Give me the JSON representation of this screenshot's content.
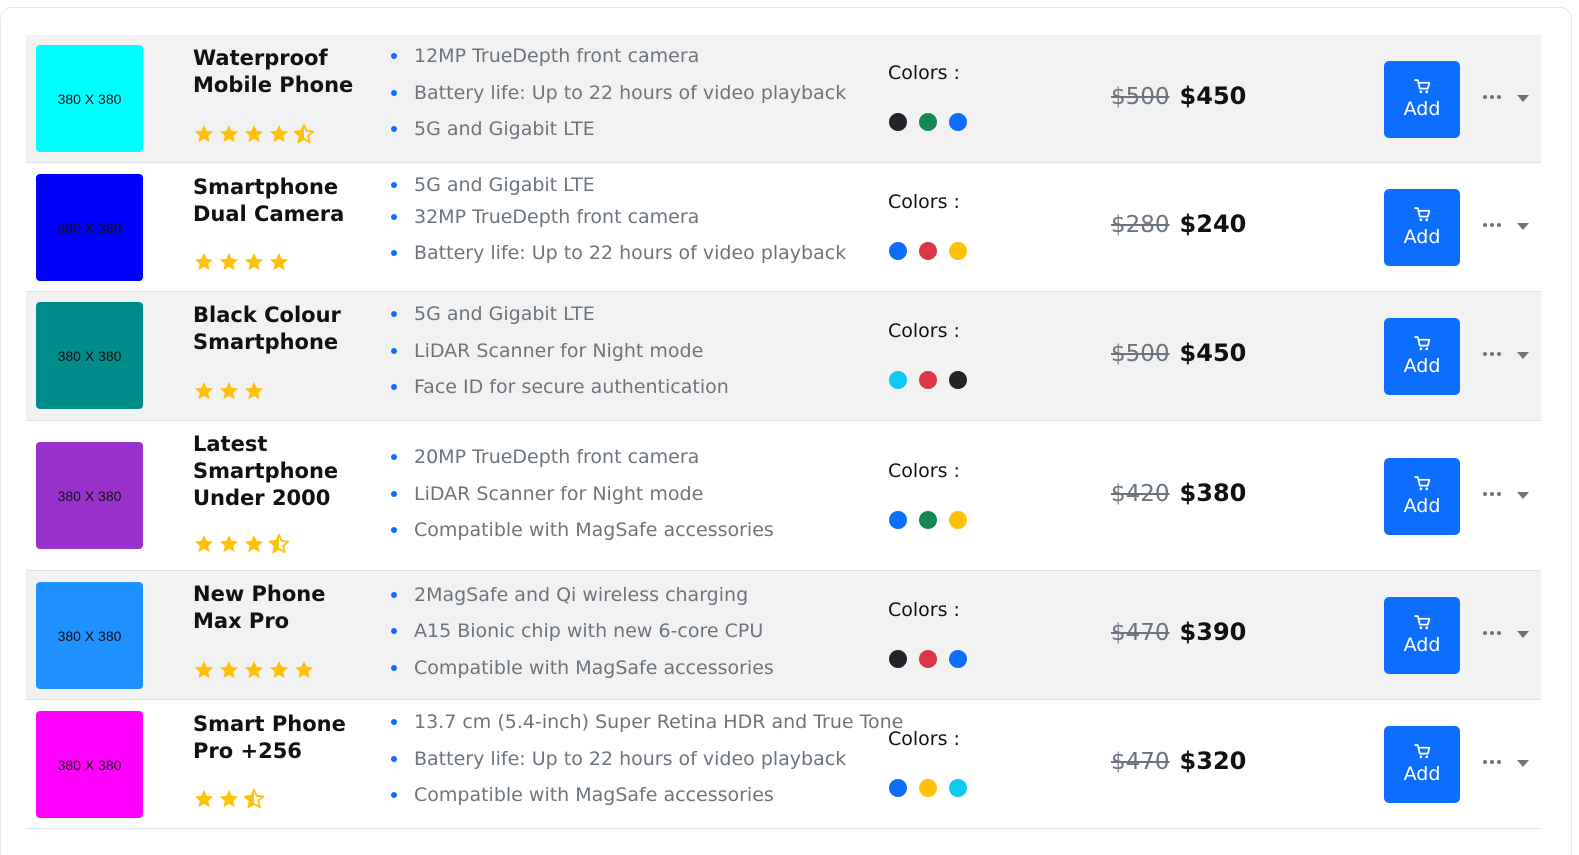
{
  "colors_label": "Colors :",
  "add_label": "Add",
  "products": [
    {
      "image_label": "380 X 380",
      "image_bg": "#00ffff",
      "name": "Waterproof Mobile Phone",
      "rating": 4.5,
      "features": [
        "12MP TrueDepth front camera",
        "Battery life: Up to 22 hours of video playback",
        "5G and Gigabit LTE"
      ],
      "colors": [
        "#212529",
        "#198754",
        "#0d6efd"
      ],
      "old_price": "$500",
      "price": "$450"
    },
    {
      "image_label": "380 X 380",
      "image_bg": "#0000ff",
      "name": "Smartphone Dual Camera",
      "rating": 4,
      "features": [
        "5G and Gigabit LTE",
        "32MP TrueDepth front camera",
        "Battery life: Up to 22 hours of video playback"
      ],
      "colors": [
        "#0d6efd",
        "#dc3545",
        "#ffc107"
      ],
      "old_price": "$280",
      "price": "$240"
    },
    {
      "image_label": "380 X 380",
      "image_bg": "#008b8b",
      "name": "Black Colour Smartphone",
      "rating": 3,
      "features": [
        "5G and Gigabit LTE",
        "LiDAR Scanner for Night mode",
        "Face ID for secure authentication"
      ],
      "colors": [
        "#0dcaf0",
        "#dc3545",
        "#212529"
      ],
      "old_price": "$500",
      "price": "$450"
    },
    {
      "image_label": "380 X 380",
      "image_bg": "#9932cc",
      "name": "Latest Smartphone Under 2000",
      "rating": 3.5,
      "features": [
        "20MP TrueDepth front camera",
        "LiDAR Scanner for Night mode",
        "Compatible with MagSafe accessories"
      ],
      "colors": [
        "#0d6efd",
        "#198754",
        "#ffc107"
      ],
      "old_price": "$420",
      "price": "$380"
    },
    {
      "image_label": "380 X 380",
      "image_bg": "#1e90ff",
      "name": "New Phone Max Pro",
      "rating": 5,
      "features": [
        "2MagSafe and Qi wireless charging",
        "A15 Bionic chip with new 6-core CPU",
        "Compatible with MagSafe accessories"
      ],
      "colors": [
        "#212529",
        "#dc3545",
        "#0d6efd"
      ],
      "old_price": "$470",
      "price": "$390"
    },
    {
      "image_label": "380 X 380",
      "image_bg": "#ff00ff",
      "name": "Smart Phone Pro +256",
      "rating": 2.5,
      "features": [
        "13.7 cm (5.4-inch) Super Retina HDR and True Tone",
        "Battery life: Up to 22 hours of video playback",
        "Compatible with MagSafe accessories"
      ],
      "colors": [
        "#0d6efd",
        "#ffc107",
        "#0dcaf0"
      ],
      "old_price": "$470",
      "price": "$320"
    }
  ]
}
